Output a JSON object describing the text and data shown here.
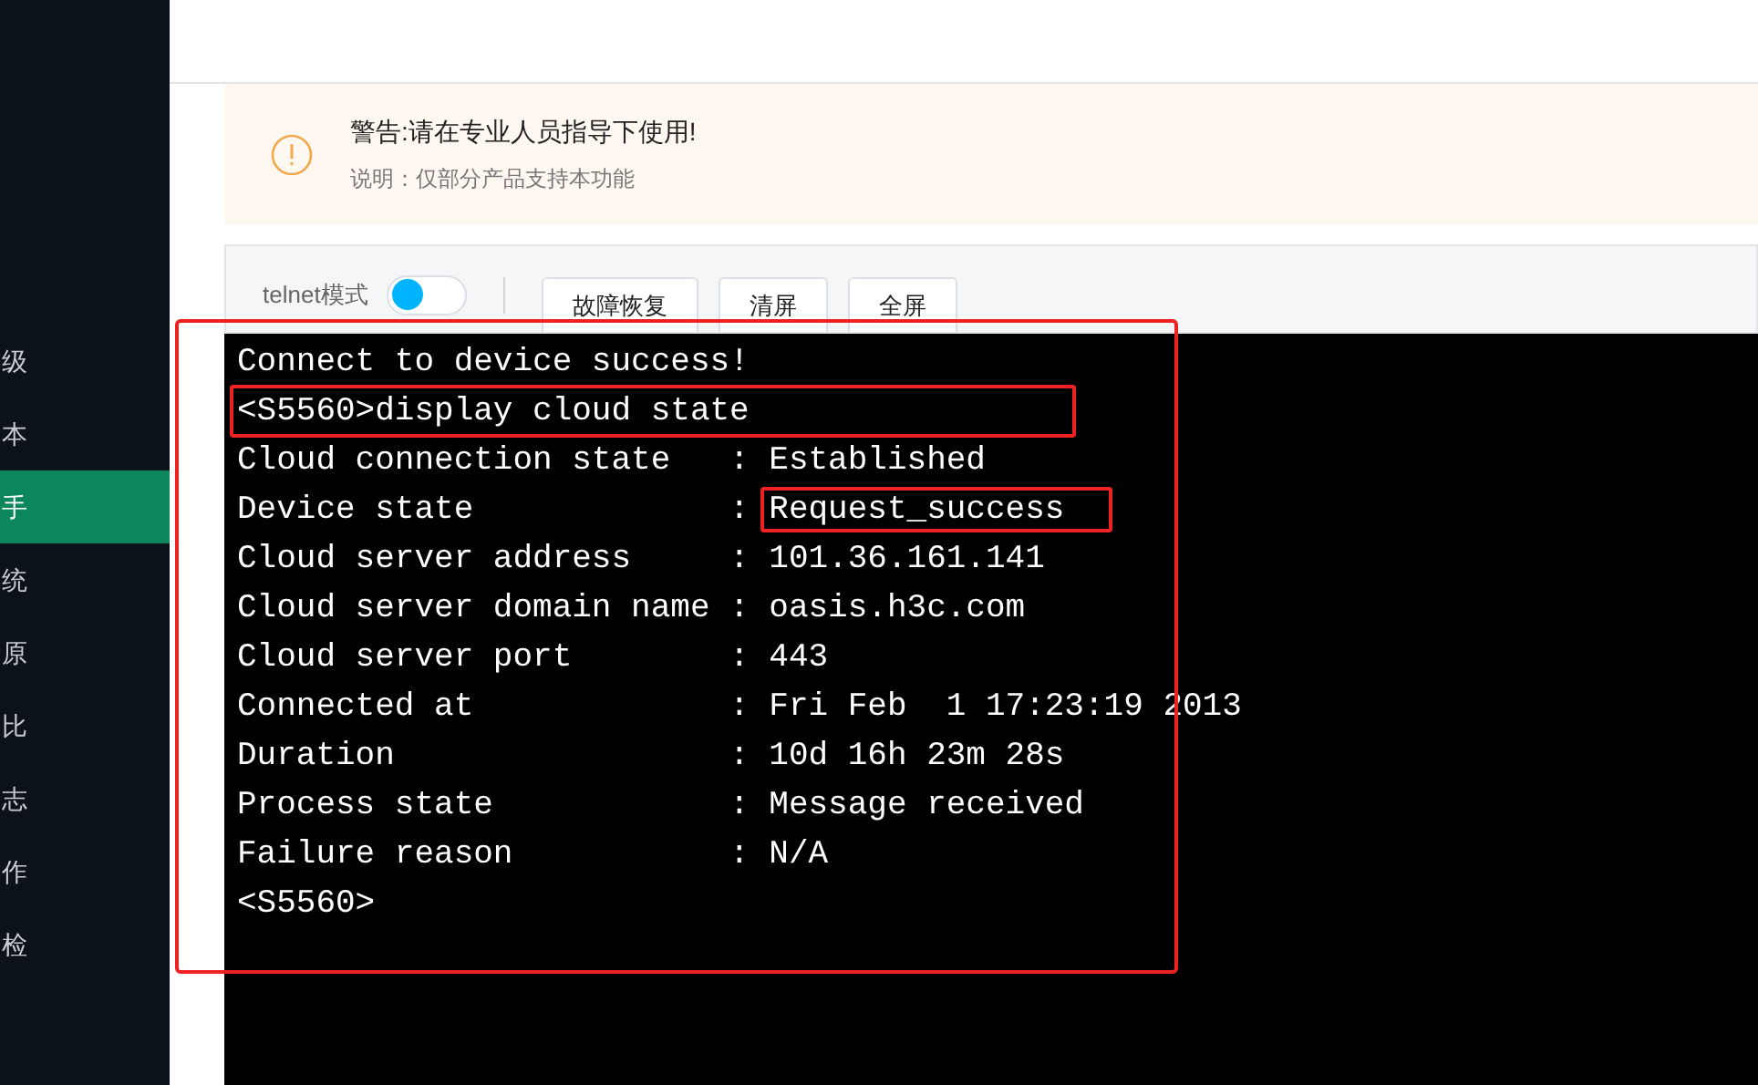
{
  "sidebar": {
    "items": [
      {
        "label": "级",
        "selected": false
      },
      {
        "label": "本",
        "selected": false
      },
      {
        "label": "手",
        "selected": true
      },
      {
        "label": "统",
        "selected": false
      },
      {
        "label": "原",
        "selected": false
      },
      {
        "label": "比",
        "selected": false
      },
      {
        "label": "志",
        "selected": false
      },
      {
        "label": "作",
        "selected": false
      },
      {
        "label": "检",
        "selected": false
      }
    ]
  },
  "warning": {
    "title": "警告:请在专业人员指导下使用!",
    "note": "说明：仅部分产品支持本功能"
  },
  "toolbar": {
    "toggle_label": "telnet模式",
    "toggle_on": false,
    "buttons": [
      "故障恢复",
      "清屏",
      "全屏"
    ]
  },
  "terminal": {
    "outlined": true,
    "lines": [
      {
        "kind": "text",
        "text": "Connect to device success!",
        "highlight": false
      },
      {
        "kind": "text",
        "text": "<S5560>display cloud state",
        "highlight": true
      },
      {
        "kind": "field",
        "label": "Cloud connection state   : ",
        "value": "Established",
        "highlight": false
      },
      {
        "kind": "field",
        "label": "Device state             : ",
        "value": "Request_success",
        "highlight": true
      },
      {
        "kind": "field",
        "label": "Cloud server address     : ",
        "value": "101.36.161.141",
        "highlight": false
      },
      {
        "kind": "field",
        "label": "Cloud server domain name : ",
        "value": "oasis.h3c.com",
        "highlight": false
      },
      {
        "kind": "field",
        "label": "Cloud server port        : ",
        "value": "443",
        "highlight": false
      },
      {
        "kind": "field",
        "label": "Connected at             : ",
        "value": "Fri Feb  1 17:23:19 2013",
        "highlight": false
      },
      {
        "kind": "field",
        "label": "Duration                 : ",
        "value": "10d 16h 23m 28s",
        "highlight": false
      },
      {
        "kind": "field",
        "label": "Process state            : ",
        "value": "Message received",
        "highlight": false
      },
      {
        "kind": "field",
        "label": "Failure reason           : ",
        "value": "N/A",
        "highlight": false
      },
      {
        "kind": "text",
        "text": "<S5560>",
        "highlight": false
      }
    ]
  }
}
